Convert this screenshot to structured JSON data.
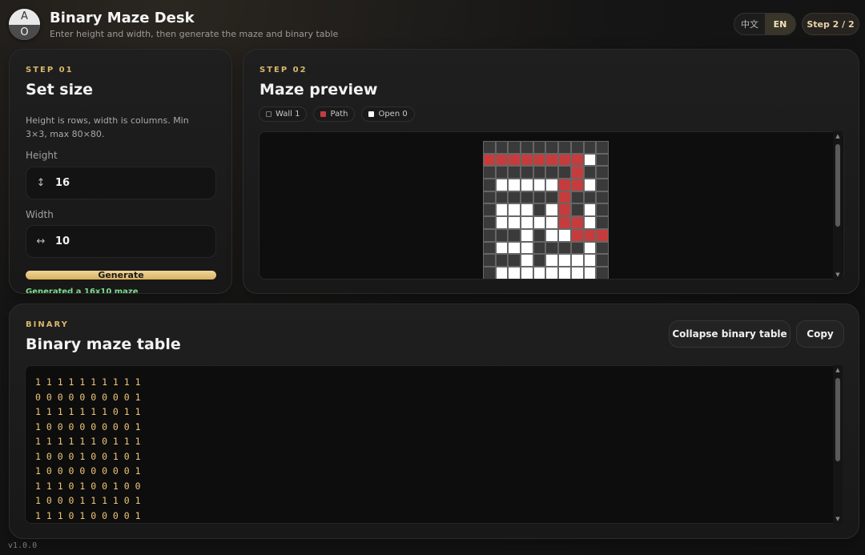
{
  "header": {
    "logo_top": "A",
    "logo_bottom": "O",
    "title": "Binary Maze Desk",
    "subtitle": "Enter height and width, then generate the maze and binary table",
    "lang_zh": "中文",
    "lang_en": "EN",
    "step": "Step 2 / 2"
  },
  "step1": {
    "label": "STEP 01",
    "title": "Set size",
    "hint": "Height is rows, width is columns. Min 3×3, max 80×80.",
    "height_label": "Height",
    "height_icon": "↕",
    "height_value": "16",
    "width_label": "Width",
    "width_icon": "↔",
    "width_value": "10",
    "generate_label": "Generate",
    "status": "Generated a 16x10 maze"
  },
  "step2": {
    "label": "STEP 02",
    "title": "Maze preview",
    "legend": {
      "wall": "Wall 1",
      "path": "Path",
      "open": "Open 0"
    }
  },
  "maze": {
    "rows": [
      "1111111111",
      "0000000001",
      "1111111011",
      "1000000001",
      "1111110111",
      "1000100101",
      "1000000001",
      "1110100100",
      "1000111101",
      "1110100001",
      "1000000001"
    ],
    "path": [
      [
        1,
        0
      ],
      [
        1,
        1
      ],
      [
        1,
        2
      ],
      [
        1,
        3
      ],
      [
        1,
        4
      ],
      [
        1,
        5
      ],
      [
        1,
        6
      ],
      [
        1,
        7
      ],
      [
        2,
        7
      ],
      [
        3,
        7
      ],
      [
        3,
        6
      ],
      [
        4,
        6
      ],
      [
        5,
        6
      ],
      [
        6,
        6
      ],
      [
        6,
        7
      ],
      [
        7,
        7
      ],
      [
        7,
        8
      ],
      [
        7,
        9
      ]
    ]
  },
  "binary": {
    "label": "BINARY",
    "title": "Binary maze table",
    "collapse_label": "Collapse binary table",
    "copy_label": "Copy",
    "lines": [
      "1 1 1 1 1 1 1 1 1 1",
      "0 0 0 0 0 0 0 0 0 1",
      "1 1 1 1 1 1 1 0 1 1",
      "1 0 0 0 0 0 0 0 0 1",
      "1 1 1 1 1 1 0 1 1 1",
      "1 0 0 0 1 0 0 1 0 1",
      "1 0 0 0 0 0 0 0 0 1",
      "1 1 1 0 1 0 0 1 0 0",
      "1 0 0 0 1 1 1 1 0 1",
      "1 1 1 0 1 0 0 0 0 1"
    ]
  },
  "colors": {
    "wall": "#3a3a3a",
    "path": "#c63c3c",
    "open": "#ffffff",
    "accent": "#d9b76c"
  },
  "version": "v1.0.0"
}
